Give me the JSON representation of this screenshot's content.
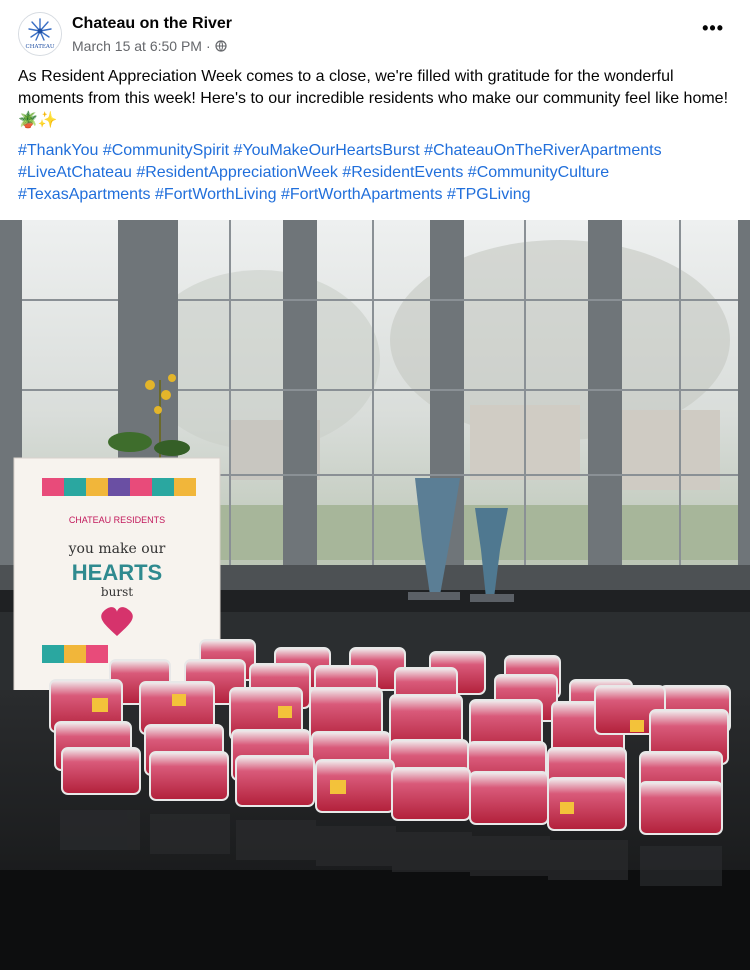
{
  "page": {
    "name": "Chateau on the River",
    "avatar_text": "CHATEAU",
    "timestamp": "March 15 at 6:50 PM",
    "separator": "·",
    "audience_icon": "globe-icon",
    "more_icon": "more-options-icon",
    "more_label": "•••"
  },
  "post": {
    "caption": "As Resident Appreciation Week comes to a close, we're filled with gratitude for the wonderful moments from this week! Here's to our incredible residents who make our community feel like home! 🪴✨",
    "hashtags": [
      "#ThankYou",
      "#CommunitySpirit",
      "#YouMakeOurHeartsBurst",
      "#ChateauOnTheRiverApartments",
      "#LiveAtChateau",
      "#ResidentAppreciationWeek",
      "#ResidentEvents",
      "#CommunityCulture",
      "#TexasApartments",
      "#FortWorthLiving",
      "#FortWorthApartments",
      "#TPGLiving"
    ]
  },
  "photo": {
    "sign": {
      "line1": "CHATEAU RESIDENTS",
      "line2": "you make our",
      "line3": "HEARTS",
      "line4": "burst"
    }
  },
  "colors": {
    "link": "#216fdb",
    "meta": "#65676b",
    "hearts_text": "#2f8a8f",
    "sign_red": "#c2185b"
  }
}
